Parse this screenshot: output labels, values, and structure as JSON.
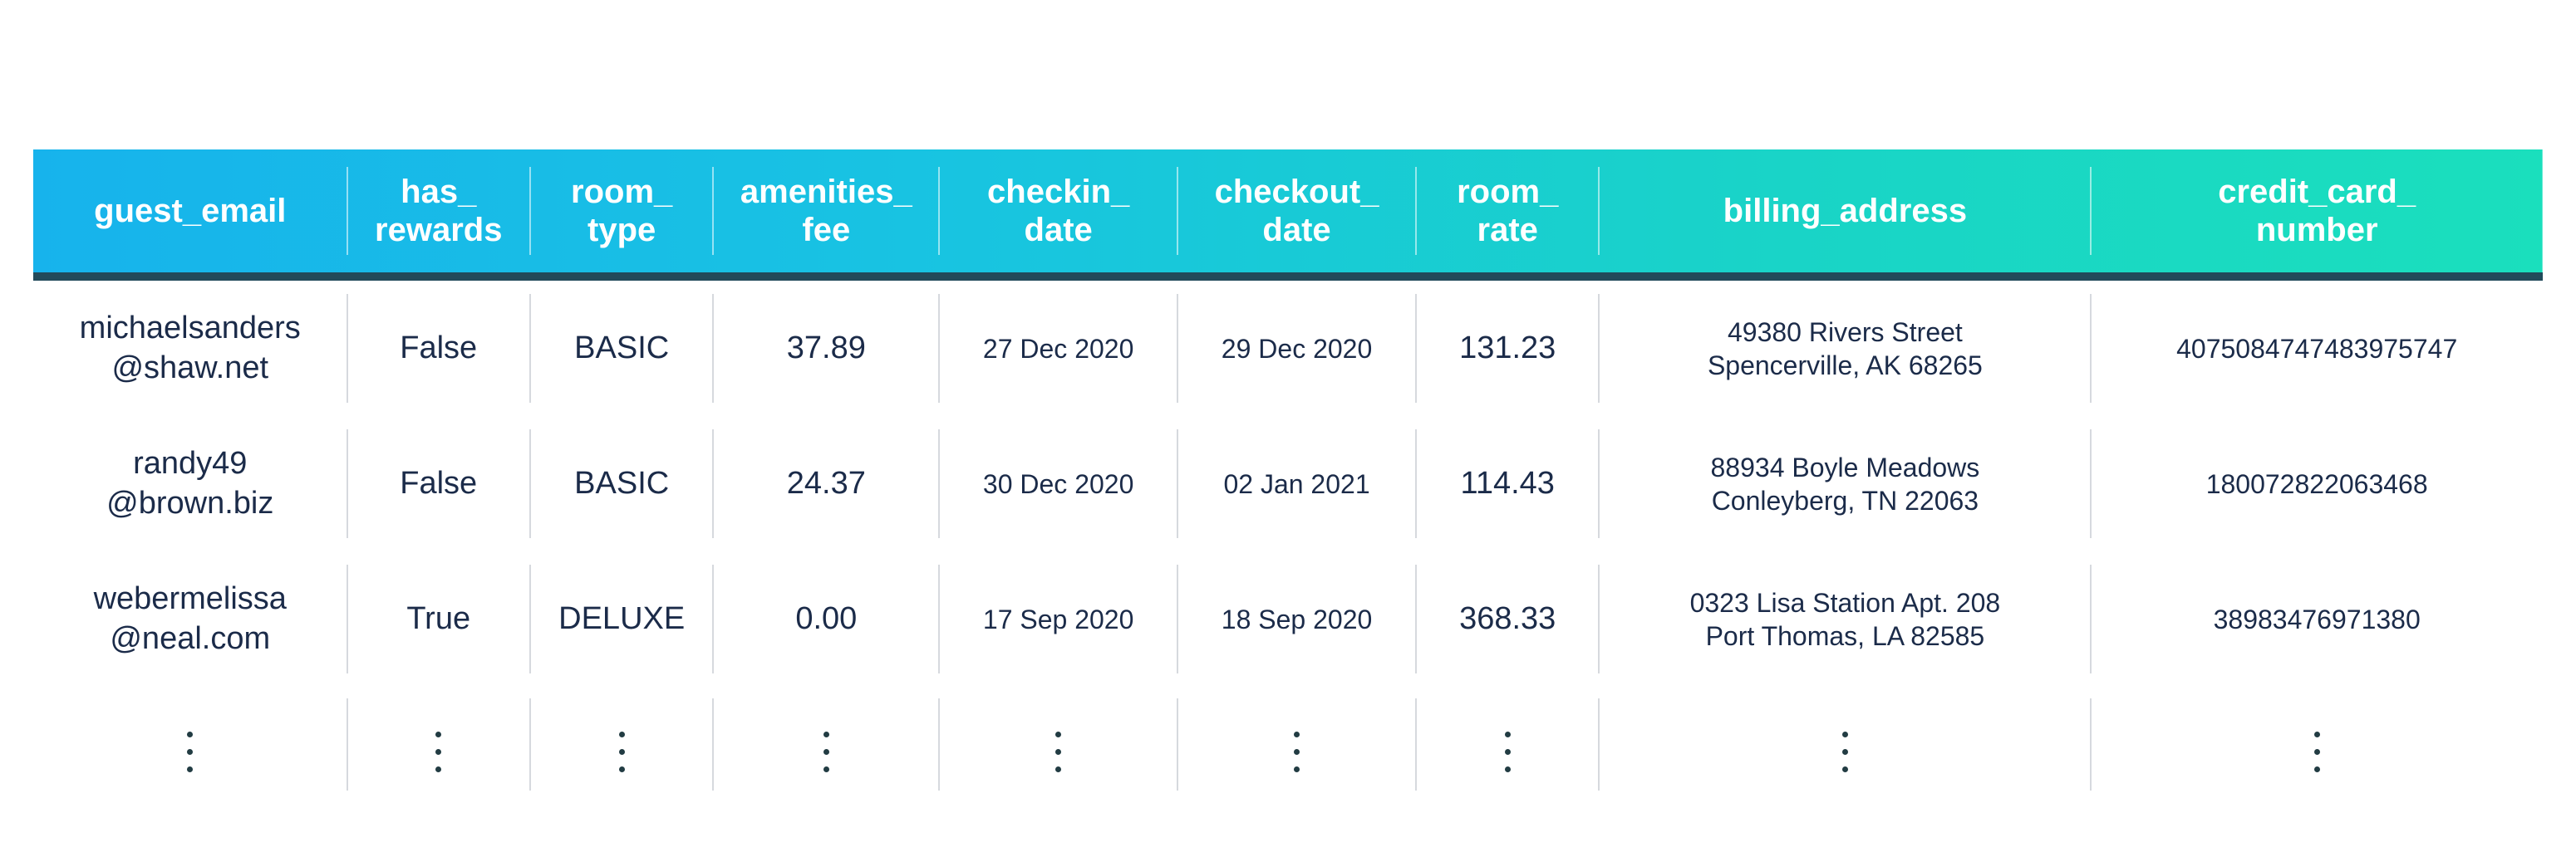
{
  "columns": [
    {
      "line1": "guest_email",
      "line2": ""
    },
    {
      "line1": "has_",
      "line2": "rewards"
    },
    {
      "line1": "room_",
      "line2": "type"
    },
    {
      "line1": "amenities_",
      "line2": "fee"
    },
    {
      "line1": "checkin_",
      "line2": "date"
    },
    {
      "line1": "checkout_",
      "line2": "date"
    },
    {
      "line1": "room_",
      "line2": "rate"
    },
    {
      "line1": "billing_address",
      "line2": ""
    },
    {
      "line1": "credit_card_",
      "line2": "number"
    }
  ],
  "rows": [
    {
      "guest_email_l1": "michaelsanders",
      "guest_email_l2": "@shaw.net",
      "has_rewards": "False",
      "room_type": "BASIC",
      "amenities_fee": "37.89",
      "checkin_date": "27 Dec 2020",
      "checkout_date": "29 Dec 2020",
      "room_rate": "131.23",
      "billing_l1": "49380 Rivers Street",
      "billing_l2": "Spencerville, AK 68265",
      "cc_number": "4075084747483975747"
    },
    {
      "guest_email_l1": "randy49",
      "guest_email_l2": "@brown.biz",
      "has_rewards": "False",
      "room_type": "BASIC",
      "amenities_fee": "24.37",
      "checkin_date": "30 Dec 2020",
      "checkout_date": "02 Jan 2021",
      "room_rate": "114.43",
      "billing_l1": "88934 Boyle Meadows",
      "billing_l2": "Conleyberg, TN 22063",
      "cc_number": "180072822063468"
    },
    {
      "guest_email_l1": "webermelissa",
      "guest_email_l2": "@neal.com",
      "has_rewards": "True",
      "room_type": "DELUXE",
      "amenities_fee": "0.00",
      "checkin_date": "17 Sep 2020",
      "checkout_date": "18 Sep 2020",
      "room_rate": "368.33",
      "billing_l1": "0323 Lisa Station Apt. 208",
      "billing_l2": "Port Thomas, LA 82585",
      "cc_number": "38983476971380"
    }
  ]
}
